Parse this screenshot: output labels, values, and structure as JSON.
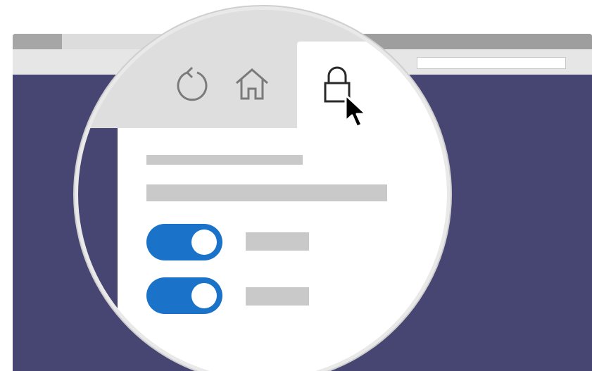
{
  "browser": {
    "toolbar_icons": [
      "refresh-icon",
      "home-icon",
      "lock-icon"
    ],
    "active_tab_icon": "lock-icon"
  },
  "settings_panel": {
    "text_lines": 2,
    "toggles": [
      {
        "name": "setting-1",
        "state": "on"
      },
      {
        "name": "setting-2",
        "state": "on"
      }
    ]
  },
  "colors": {
    "window_background": "#474571",
    "toggle_on": "#1a73c9",
    "placeholder": "#c9c9c9",
    "magnifier": "#dedede"
  },
  "cursor": "pointer-arrow"
}
